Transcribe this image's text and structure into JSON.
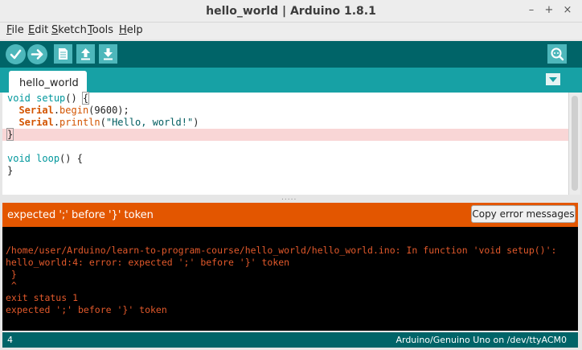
{
  "window": {
    "title": "hello_world | Arduino 1.8.1",
    "minimize_glyph": "–",
    "maximize_glyph": "+",
    "close_glyph": "×"
  },
  "menu": [
    {
      "underline": "F",
      "rest": "ile"
    },
    {
      "underline": "E",
      "rest": "dit"
    },
    {
      "underline": "S",
      "rest": "ketch"
    },
    {
      "underline": "T",
      "rest": "ools"
    },
    {
      "underline": "H",
      "rest": "elp"
    }
  ],
  "toolbar": {
    "icons": [
      "verify-check-icon",
      "upload-arrow-icon",
      "new-file-icon",
      "open-up-arrow-icon",
      "save-down-arrow-icon",
      "serial-monitor-icon"
    ]
  },
  "tabs": [
    {
      "label": "hello_world"
    }
  ],
  "editor": {
    "lines": [
      "void setup() {",
      "  Serial.begin(9600);",
      "  Serial.println(\"Hello, world!\")",
      "}",
      "",
      "void loop() {",
      "}"
    ],
    "highlighted_line": 4
  },
  "divider": {
    "grip": "....."
  },
  "error": {
    "message": "expected ';' before '}' token",
    "copy_button": "Copy error messages"
  },
  "console": {
    "lines": [
      "",
      "/home/user/Arduino/learn-to-program-course/hello_world/hello_world.ino: In function 'void setup()':",
      "hello_world:4: error: expected ';' before '}' token",
      " }",
      " ^",
      "exit status 1",
      "expected ';' before '}' token"
    ]
  },
  "status": {
    "line_number": "4",
    "board": "Arduino/Genuino Uno on /dev/ttyACM0"
  },
  "colors": {
    "toolbar": "#006468",
    "tabbar": "#17a1a5",
    "button": "#4db7bb",
    "error_bar": "#e35600",
    "console_text": "#e2592b"
  }
}
